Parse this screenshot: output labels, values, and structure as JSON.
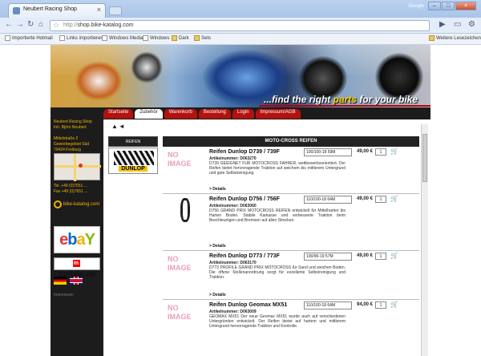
{
  "browser": {
    "tab_title": "Neubert Racing Shop",
    "url_scheme": "http://",
    "url_rest": "shop.bike-katalog.com",
    "window_label": "Google"
  },
  "bookmarks": {
    "items": [
      "Importierte Hotmail",
      "Links importieren",
      "Windows Media",
      "Windows",
      "Dark",
      "Sets"
    ],
    "other": "Weitere Lesezeichen"
  },
  "site": {
    "slogan_pre": "...find the right ",
    "slogan_hi": "parts",
    "slogan_post": " for your bike",
    "nav": [
      "Startseite",
      "Zubehör",
      "Warenkorb",
      "Bestellung",
      "Login",
      "Impressum/AGB"
    ],
    "active_nav": 1,
    "sidebar": {
      "address": "Neubert Racing Shop\nInh. Björn Neubert\n\nMittelstraße 2\nGewerbegebiet Süd\n79424 Freiburg\nGermany",
      "phone": "Tel. +49 (0)7651 ...\nFax +49 (0)7651 ...",
      "katalog": "bike-katalog.com",
      "mobile": "mobile.de",
      "footer": "Impressum"
    },
    "category": {
      "header": "REIFEN",
      "brand": "DUNLOP"
    },
    "list_header": "MOTO-CROSS REIFEN",
    "no_image": "NO IMAGE",
    "detail_link": "> Details",
    "products": [
      {
        "title": "Reifen Dunlop D739 / 739F",
        "size": "100/100-18 59M",
        "price": "49,00 €",
        "qty": "1",
        "article": "Artikelnummer: D063270",
        "desc": "D739 GEEIGNET FÜR MOTOCROSS FAHRER, wettbewerbsorientiert. Der Reifen bietet hervorragende Traktion auf weichem bis mittlerem Untergrund und gute Selbstreinigung.",
        "image": "none"
      },
      {
        "title": "Reifen Dunlop D756 / 756F",
        "size": "110/100-18 64M",
        "price": "49,00 €",
        "qty": "1",
        "article": "Artikelnummer: D063060",
        "desc": "D756 GRAND PRIX MOTOCROSS REIFEN entwickelt für Mittelharten bis Harten Boden. Stabile Karkasse und verbesserte Traktion beim Beschleunigen und Bremsen auf allen Strecken.",
        "image": "tire"
      },
      {
        "title": "Reifen Dunlop D773 / 773F",
        "size": "100/90-19 57M",
        "price": "49,00 €",
        "qty": "1",
        "article": "Artikelnummer: D063170",
        "desc": "D773 PROFILE GRAND PRIX MOTOCROSS für Sand und weichen Boden. Die offene Stollenanordnung sorgt für exzellente Selbstreinigung und Traktion.",
        "image": "none"
      },
      {
        "title": "Reifen Dunlop Geomax MX51",
        "size": "110/100-18 64M",
        "price": "94,00 €",
        "qty": "1",
        "article": "Artikelnummer: D063009",
        "desc": "GEOMAX MX51 Der neue Geomax MX51 wurde auch auf verschiedenen Untergründen entwickelt. Der Reifen bietet auf hartem und mittlerem Untergrund hervorragende Traktion und Kontrolle.",
        "image": "none"
      }
    ]
  }
}
